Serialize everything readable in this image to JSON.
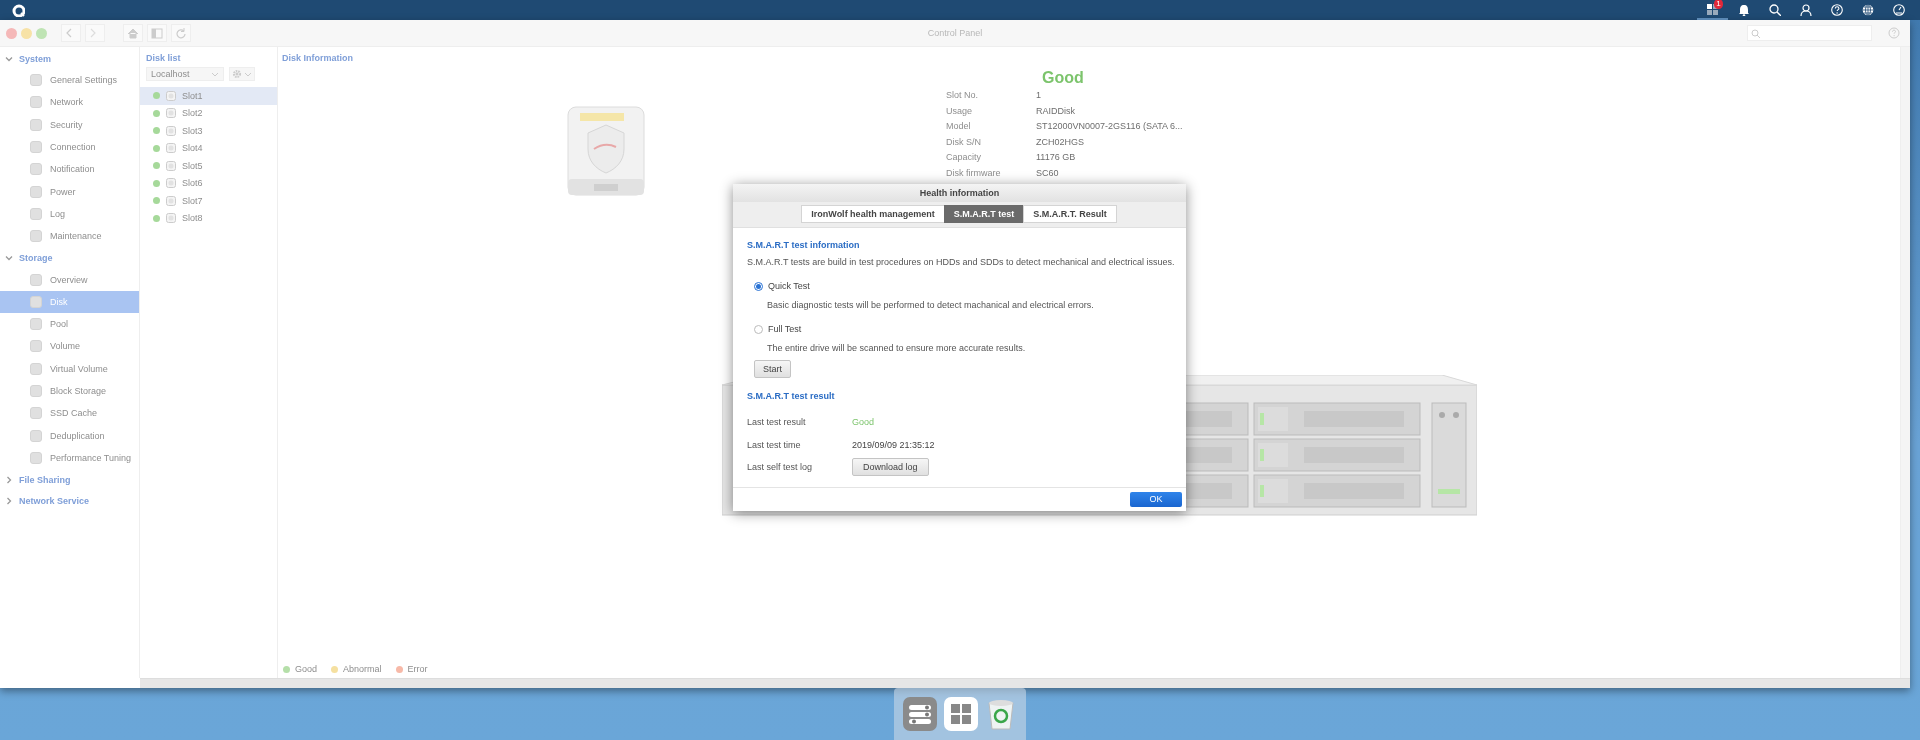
{
  "topbar": {
    "badge": "1"
  },
  "window": {
    "title": "Control Panel"
  },
  "sidebar": {
    "groups": [
      {
        "label": "System",
        "expanded": true,
        "items": [
          {
            "label": "General Settings",
            "selected": false
          },
          {
            "label": "Network",
            "selected": false
          },
          {
            "label": "Security",
            "selected": false
          },
          {
            "label": "Connection",
            "selected": false
          },
          {
            "label": "Notification",
            "selected": false
          },
          {
            "label": "Power",
            "selected": false
          },
          {
            "label": "Log",
            "selected": false
          },
          {
            "label": "Maintenance",
            "selected": false
          }
        ]
      },
      {
        "label": "Storage",
        "expanded": true,
        "items": [
          {
            "label": "Overview",
            "selected": false
          },
          {
            "label": "Disk",
            "selected": true
          },
          {
            "label": "Pool",
            "selected": false
          },
          {
            "label": "Volume",
            "selected": false
          },
          {
            "label": "Virtual Volume",
            "selected": false
          },
          {
            "label": "Block Storage",
            "selected": false
          },
          {
            "label": "SSD Cache",
            "selected": false
          },
          {
            "label": "Deduplication",
            "selected": false
          },
          {
            "label": "Performance Tuning",
            "selected": false
          }
        ]
      },
      {
        "label": "File Sharing",
        "expanded": false
      },
      {
        "label": "Network Service",
        "expanded": false
      }
    ]
  },
  "disk_list": {
    "title": "Disk list",
    "host": "Localhost",
    "slots": [
      {
        "label": "Slot1",
        "color": "#a6d99a",
        "selected": true
      },
      {
        "label": "Slot2",
        "color": "#a6d99a",
        "selected": false
      },
      {
        "label": "Slot3",
        "color": "#a6d99a",
        "selected": false
      },
      {
        "label": "Slot4",
        "color": "#a6d99a",
        "selected": false
      },
      {
        "label": "Slot5",
        "color": "#a6d99a",
        "selected": false
      },
      {
        "label": "Slot6",
        "color": "#a6d99a",
        "selected": false
      },
      {
        "label": "Slot7",
        "color": "#a6d99a",
        "selected": false
      },
      {
        "label": "Slot8",
        "color": "#a6d99a",
        "selected": false
      }
    ]
  },
  "disk_info": {
    "title": "Disk Information",
    "status": "Good",
    "fields": [
      {
        "label": "Slot No.",
        "value": "1"
      },
      {
        "label": "Usage",
        "value": "RAIDDisk"
      },
      {
        "label": "Model",
        "value": "ST12000VN0007-2GS116 (SATA 6..."
      },
      {
        "label": "Disk S/N",
        "value": "ZCH02HGS"
      },
      {
        "label": "Capacity",
        "value": "11176 GB"
      },
      {
        "label": "Disk firmware",
        "value": "SC60"
      }
    ]
  },
  "legend": [
    {
      "label": "Good",
      "color": "#b5dfa9"
    },
    {
      "label": "Abnormal",
      "color": "#f5e0a0"
    },
    {
      "label": "Error",
      "color": "#f7b9a8"
    }
  ],
  "dialog": {
    "title": "Health information",
    "tabs": [
      {
        "label": "IronWolf health management",
        "selected": false
      },
      {
        "label": "S.M.A.R.T test",
        "selected": true
      },
      {
        "label": "S.M.A.R.T. Result",
        "selected": false
      }
    ],
    "info_title": "S.M.A.R.T test information",
    "info_text": "S.M.A.R.T tests are build in test procedures on HDDs and SDDs to detect mechanical and electrical issues.",
    "options": [
      {
        "label": "Quick Test",
        "description": "Basic diagnostic tests will be performed to detect machanical and electrical errors.",
        "selected": true
      },
      {
        "label": "Full Test",
        "description": "The entire drive will be scanned to ensure more accurate results.",
        "selected": false
      }
    ],
    "start_button": "Start",
    "result_title": "S.M.A.R.T test result",
    "results": [
      {
        "label": "Last test result",
        "value": "Good",
        "kind": "status"
      },
      {
        "label": "Last test time",
        "value": "2019/09/09 21:35:12",
        "kind": "text"
      },
      {
        "label": "Last self test log",
        "value": "Download log",
        "kind": "button"
      }
    ],
    "ok_button": "OK"
  }
}
